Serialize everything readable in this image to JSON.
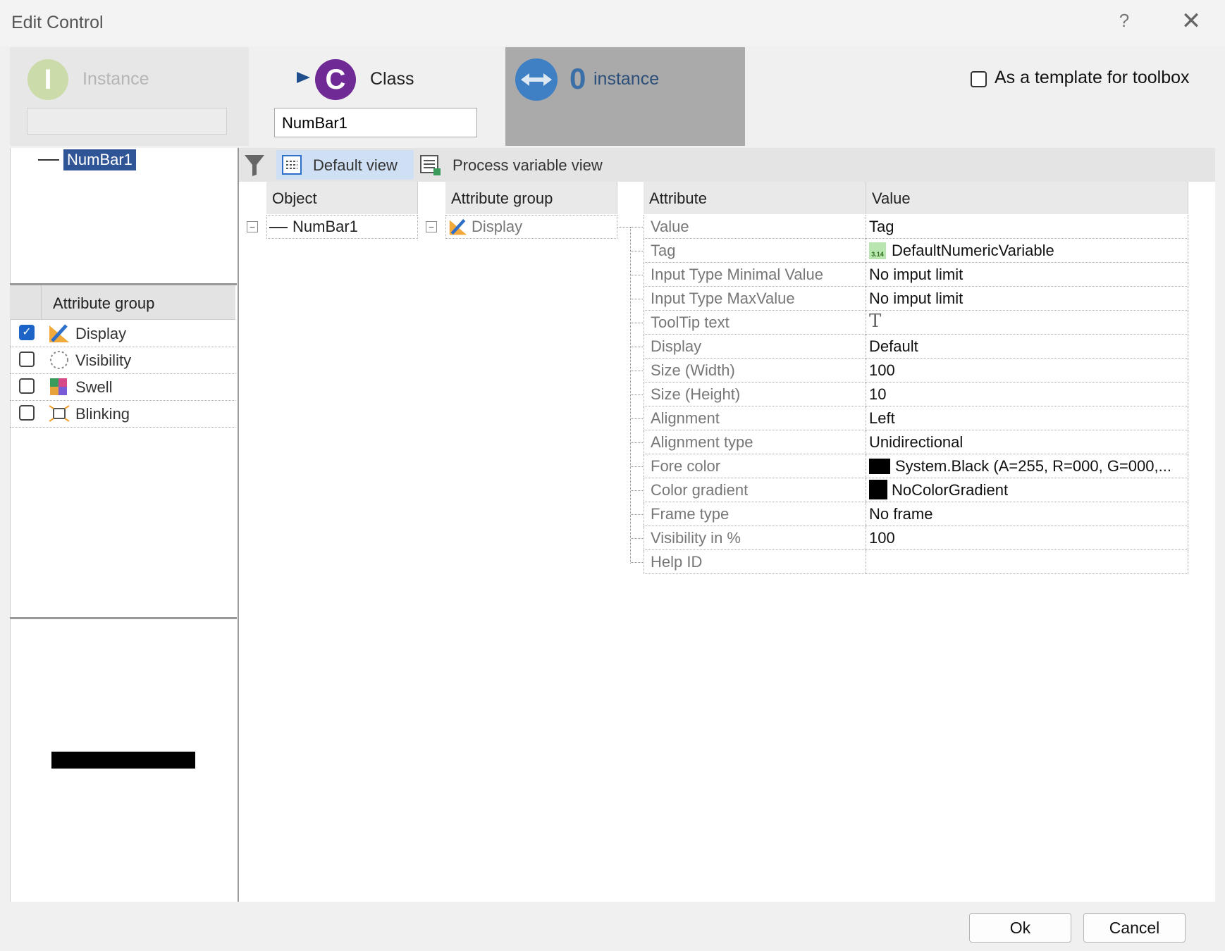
{
  "window": {
    "title": "Edit Control",
    "help_label": "?",
    "close_label": "✕"
  },
  "header": {
    "instance": {
      "letter": "I",
      "label": "Instance",
      "input_value": "",
      "color": "#cbdcaa"
    },
    "class": {
      "letter": "C",
      "label": "Class",
      "input_value": "NumBar1",
      "color": "#6f2a96"
    },
    "instances": {
      "count": "0",
      "label": "instance",
      "color": "#3f7fc4"
    },
    "template_checkbox": {
      "label": "As a template for toolbox",
      "checked": false
    }
  },
  "tree": {
    "selected_node": "NumBar1"
  },
  "attribute_groups": {
    "header": "Attribute group",
    "items": [
      {
        "label": "Display",
        "checked": true,
        "icon": "pencil-ruler-icon"
      },
      {
        "label": "Visibility",
        "checked": false,
        "icon": "dashed-circle-icon"
      },
      {
        "label": "Swell",
        "checked": false,
        "icon": "chart-icon"
      },
      {
        "label": "Blinking",
        "checked": false,
        "icon": "blink-icon"
      }
    ]
  },
  "toolbar": {
    "filter_icon": "filter-icon",
    "default_view": "Default view",
    "process_variable_view": "Process variable view"
  },
  "grid": {
    "object_header": "Object",
    "group_header": "Attribute group",
    "attribute_header": "Attribute",
    "value_header": "Value",
    "object": "NumBar1",
    "group": "Display",
    "expander": "−",
    "attributes": [
      {
        "name": "Value",
        "value": "Tag"
      },
      {
        "name": "Tag",
        "value": "DefaultNumericVariable",
        "icon": "numeric-variable-icon",
        "icon_text": "3.14"
      },
      {
        "name": "Input Type Minimal Value",
        "value": "No imput limit"
      },
      {
        "name": "Input Type MaxValue",
        "value": "No imput limit"
      },
      {
        "name": "ToolTip text",
        "value": "",
        "icon": "text-t-icon",
        "icon_text": "T"
      },
      {
        "name": "Display",
        "value": "Default"
      },
      {
        "name": "Size (Width)",
        "value": "100"
      },
      {
        "name": "Size (Height)",
        "value": "10"
      },
      {
        "name": "Alignment",
        "value": "Left"
      },
      {
        "name": "Alignment type",
        "value": "Unidirectional"
      },
      {
        "name": "Fore color",
        "value": "System.Black  (A=255,  R=000,  G=000,...",
        "swatch": "#000000"
      },
      {
        "name": "Color gradient",
        "value": "NoColorGradient",
        "swatch": "#000000"
      },
      {
        "name": "Frame type",
        "value": "No frame"
      },
      {
        "name": "Visibility in %",
        "value": "100"
      },
      {
        "name": "Help ID",
        "value": ""
      }
    ]
  },
  "footer": {
    "ok_label": "Ok",
    "cancel_label": "Cancel"
  }
}
